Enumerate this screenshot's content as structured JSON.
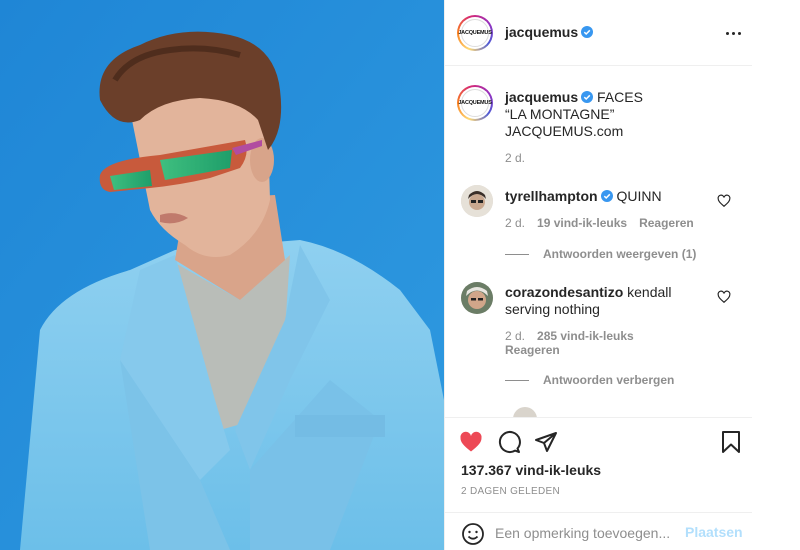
{
  "header": {
    "username": "jacquemus",
    "avatar_logo": "JACQUEMUS",
    "more_icon": "more-horizontal-icon"
  },
  "caption": {
    "username": "jacquemus",
    "line1": "FACES",
    "line2": "“LA MONTAGNE”",
    "line3": "JACQUEMUS.com",
    "time": "2 d."
  },
  "comments": [
    {
      "username": "tyrellhampton",
      "verified": true,
      "text": "QUINN",
      "time": "2 d.",
      "likes": "19 vind-ik-leuks",
      "reply_label": "Reageren",
      "replies_toggle": "Antwoorden weergeven (1)"
    },
    {
      "username": "corazondesantizo",
      "verified": false,
      "text_line1": "kendall",
      "text_line2": "serving nothing",
      "time": "2 d.",
      "likes": "285 vind-ik-leuks",
      "reply_label": "Reageren",
      "replies_toggle": "Antwoorden verbergen"
    }
  ],
  "actions": {
    "like_icon": "heart-filled-icon",
    "comment_icon": "comment-bubble-icon",
    "share_icon": "paper-plane-icon",
    "save_icon": "bookmark-icon",
    "likes_count": "137.367 vind-ik-leuks",
    "posted_date": "2 DAGEN GELEDEN"
  },
  "comment_box": {
    "emoji_icon": "smiley-icon",
    "placeholder": "Een opmerking toevoegen...",
    "post_label": "Plaatsen"
  },
  "colors": {
    "like_red": "#ed4956",
    "verified_blue": "#3897f0",
    "post_button_disabled": "#b2dffc",
    "photo_background": "#2a8fd8"
  }
}
